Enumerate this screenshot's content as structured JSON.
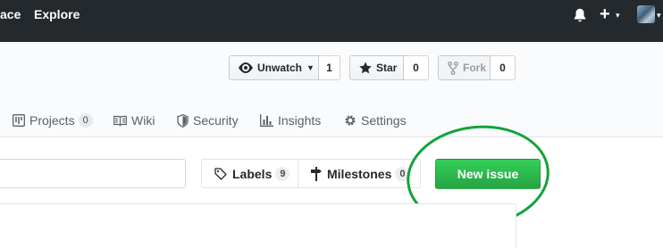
{
  "header": {
    "nav": [
      "ace",
      "Explore"
    ],
    "icons": [
      "bell-icon",
      "plus-icon",
      "avatar"
    ]
  },
  "repo_actions": {
    "watch_label": "Unwatch",
    "watch_count": "1",
    "star_label": "Star",
    "star_count": "0",
    "fork_label": "Fork",
    "fork_count": "0"
  },
  "tabs": [
    {
      "label": "Projects",
      "count": "0",
      "icon": "project-icon"
    },
    {
      "label": "Wiki",
      "icon": "book-icon"
    },
    {
      "label": "Security",
      "icon": "shield-icon"
    },
    {
      "label": "Insights",
      "icon": "graph-icon"
    },
    {
      "label": "Settings",
      "icon": "gear-icon"
    }
  ],
  "issues_toolbar": {
    "labels_label": "Labels",
    "labels_count": "9",
    "milestones_label": "Milestones",
    "milestones_count": "0",
    "new_issue_label": "New issue"
  },
  "colors": {
    "header_bg": "#24292e",
    "primary_button": "#2ea44f",
    "annotation_circle": "#13a23a"
  }
}
